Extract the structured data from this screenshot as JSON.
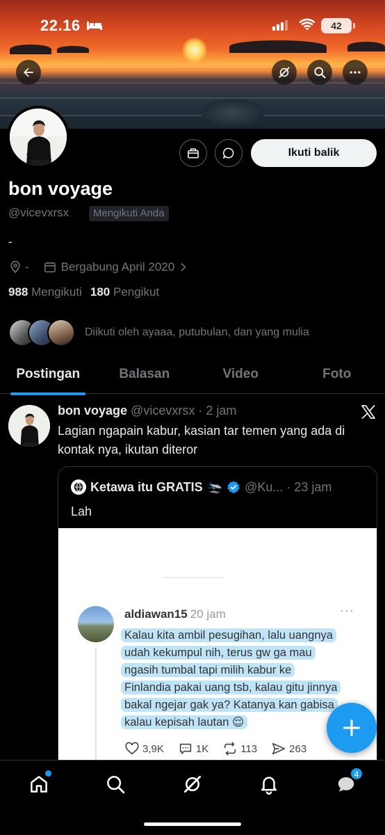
{
  "status_bar": {
    "time": "22.16",
    "battery": "42"
  },
  "profile": {
    "name": "bon voyage",
    "handle": "@vicevxrsx",
    "follows_you": "Mengikuti Anda",
    "bio": "-",
    "location": "-",
    "joined": "Bergabung April 2020",
    "following_count": "988",
    "following_label": "Mengikuti",
    "followers_count": "180",
    "followers_label": "Pengikut",
    "followed_by": "Diikuti oleh ayaaa, putubulan, dan yang mulia",
    "follow_back_label": "Ikuti balik"
  },
  "tabs": [
    {
      "label": "Postingan",
      "active": true
    },
    {
      "label": "Balasan"
    },
    {
      "label": "Video"
    },
    {
      "label": "Foto"
    }
  ],
  "post": {
    "name": "bon voyage",
    "meta": "@vicevxrsx · 2 jam",
    "text": "Lagian ngapain kabur, kasian tar temen yang ada di kontak nya, ikutan diteror",
    "quote": {
      "name": "Ketawa itu GRATIS",
      "emoji": "🛬",
      "meta": "@Ku... · 23 jam",
      "text": "Lah",
      "screenshot": {
        "username": "aldiawan15",
        "time": "20 jam",
        "lines": [
          "Kalau kita ambil pesugihan, lalu uangnya",
          "udah kekumpul nih, terus gw ga mau",
          "ngasih tumbal tapi milih kabur ke",
          "Finlandia pakai uang tsb, kalau gitu jinnya",
          "bakal ngejar gak ya? Katanya kan gabisa",
          "kalau kepisah lautan 😌"
        ],
        "likes": "3,9K",
        "comments": "1K",
        "reposts": "113",
        "shares": "263"
      }
    }
  },
  "bottom_nav": {
    "messages_badge": "4"
  },
  "colors": {
    "accent": "#1d9bf0",
    "background": "#000000",
    "muted": "#71767b",
    "highlight": "#bfe3f7"
  }
}
